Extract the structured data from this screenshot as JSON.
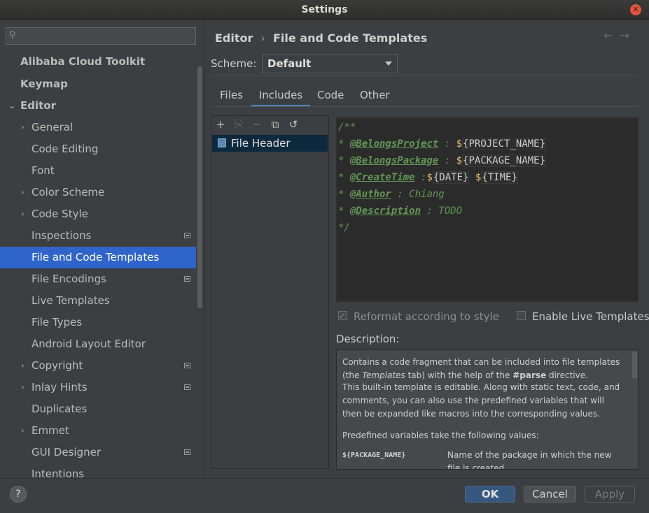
{
  "window": {
    "title": "Settings"
  },
  "search": {
    "placeholder": ""
  },
  "sidebar": {
    "items": [
      {
        "label": "Alibaba Cloud Toolkit"
      },
      {
        "label": "Keymap"
      },
      {
        "label": "Editor"
      },
      {
        "label": "General"
      },
      {
        "label": "Code Editing"
      },
      {
        "label": "Font"
      },
      {
        "label": "Color Scheme"
      },
      {
        "label": "Code Style"
      },
      {
        "label": "Inspections"
      },
      {
        "label": "File and Code Templates"
      },
      {
        "label": "File Encodings"
      },
      {
        "label": "Live Templates"
      },
      {
        "label": "File Types"
      },
      {
        "label": "Android Layout Editor"
      },
      {
        "label": "Copyright"
      },
      {
        "label": "Inlay Hints"
      },
      {
        "label": "Duplicates"
      },
      {
        "label": "Emmet"
      },
      {
        "label": "GUI Designer"
      },
      {
        "label": "Intentions"
      }
    ]
  },
  "breadcrumb": {
    "parent": "Editor",
    "sep": "›",
    "current": "File and Code Templates"
  },
  "nav": {
    "back": "←",
    "forward": "→"
  },
  "scheme": {
    "label": "Scheme:",
    "value": "Default"
  },
  "tabs": [
    {
      "label": "Files"
    },
    {
      "label": "Includes"
    },
    {
      "label": "Code"
    },
    {
      "label": "Other"
    }
  ],
  "toolbar": {
    "add": "+",
    "copy_disabled": "⎘",
    "remove": "−",
    "copy": "⧉",
    "reset": "↺"
  },
  "templates": {
    "items": [
      {
        "label": "File Header"
      }
    ]
  },
  "editor": {
    "line1": "/**",
    "line2_star": "* ",
    "line2_tag": "@BelongsProject",
    "line2_colon": " : ",
    "line2_dollar": "$",
    "line2_var": "{PROJECT_NAME}",
    "line3_star": "* ",
    "line3_tag": "@BelongsPackage",
    "line3_colon": " : ",
    "line3_dollar": "$",
    "line3_var": "{PACKAGE_NAME}",
    "line4_star": "* ",
    "line4_tag": "@CreateTime",
    "line4_colon": " :",
    "line4_dollar1": "$",
    "line4_var1": "{DATE}",
    "line4_space": " ",
    "line4_dollar2": "$",
    "line4_var2": "{TIME}",
    "line5_star": "* ",
    "line5_tag": "@Author",
    "line5_rest": " : Chiang",
    "line6_star": "* ",
    "line6_tag": "@Description",
    "line6_rest": " : TODO",
    "line7": "*/"
  },
  "options": {
    "reformat": "Reformat according to style",
    "live_templates": "Enable Live Templates"
  },
  "description": {
    "label": "Description:",
    "p1_a": "Contains a code fragment that can be included into file templates (the ",
    "p1_em": "Templates",
    "p1_b": " tab) with the help of the ",
    "p1_k": "#parse",
    "p1_c": " directive.",
    "p2": "This built-in template is editable. Along with static text, code, and comments, you can also use the predefined variables that will then be expanded like macros into the corresponding values.",
    "p3": "Predefined variables take the following values:",
    "var1": "${PACKAGE_NAME}",
    "var1_desc": "Name of the package in which the new file is created"
  },
  "footer": {
    "help": "?",
    "ok": "OK",
    "cancel": "Cancel",
    "apply": "Apply"
  }
}
